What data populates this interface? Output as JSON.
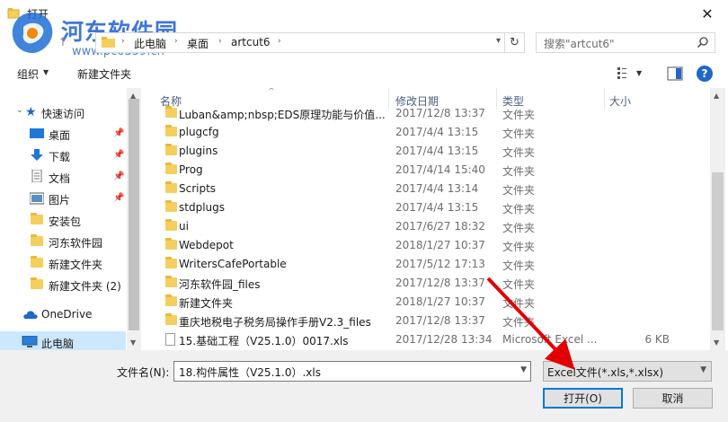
{
  "window": {
    "title": "打开",
    "close_glyph": "✕"
  },
  "watermark": {
    "text": "河东软件园",
    "url": "www.pc0359.cn"
  },
  "address": {
    "crumbs": [
      "此电脑",
      "桌面",
      "artcut6"
    ],
    "refresh_glyph": "↻"
  },
  "search": {
    "placeholder": "搜索\"artcut6\""
  },
  "toolbar": {
    "organize_label": "组织",
    "new_folder_label": "新建文件夹"
  },
  "sidebar": {
    "items": [
      {
        "label": "快速访问",
        "icon": "star-icon"
      },
      {
        "label": "桌面",
        "icon": "desktop-icon",
        "pinned": true
      },
      {
        "label": "下载",
        "icon": "download-icon",
        "pinned": true
      },
      {
        "label": "文档",
        "icon": "document-icon",
        "pinned": true
      },
      {
        "label": "图片",
        "icon": "picture-icon",
        "pinned": true
      },
      {
        "label": "安装包",
        "icon": "folder-icon"
      },
      {
        "label": "河东软件园",
        "icon": "folder-icon"
      },
      {
        "label": "新建文件夹",
        "icon": "folder-icon"
      },
      {
        "label": "新建文件夹 (2)",
        "icon": "folder-icon"
      },
      {
        "label": "OneDrive",
        "icon": "cloud-icon"
      },
      {
        "label": "此电脑",
        "icon": "computer-icon",
        "selected": true
      }
    ]
  },
  "columns": {
    "name": "名称",
    "date": "修改日期",
    "type": "类型",
    "size": "大小"
  },
  "files": [
    {
      "name": "Luban&amp;nbsp;EDS原理功能与价值...",
      "date": "2017/12/8 13:37",
      "type": "文件夹",
      "size": "",
      "kind": "folder"
    },
    {
      "name": "plugcfg",
      "date": "2017/4/4 13:15",
      "type": "文件夹",
      "size": "",
      "kind": "folder"
    },
    {
      "name": "plugins",
      "date": "2017/4/4 13:15",
      "type": "文件夹",
      "size": "",
      "kind": "folder"
    },
    {
      "name": "Prog",
      "date": "2017/4/14 15:40",
      "type": "文件夹",
      "size": "",
      "kind": "folder"
    },
    {
      "name": "Scripts",
      "date": "2017/4/4 13:14",
      "type": "文件夹",
      "size": "",
      "kind": "folder"
    },
    {
      "name": "stdplugs",
      "date": "2017/4/4 13:15",
      "type": "文件夹",
      "size": "",
      "kind": "folder"
    },
    {
      "name": "ui",
      "date": "2017/6/27 18:32",
      "type": "文件夹",
      "size": "",
      "kind": "folder"
    },
    {
      "name": "Webdepot",
      "date": "2018/1/27 10:37",
      "type": "文件夹",
      "size": "",
      "kind": "folder"
    },
    {
      "name": "WritersCafePortable",
      "date": "2017/5/12 17:13",
      "type": "文件夹",
      "size": "",
      "kind": "folder"
    },
    {
      "name": "河东软件园_files",
      "date": "2017/12/8 13:37",
      "type": "文件夹",
      "size": "",
      "kind": "folder"
    },
    {
      "name": "新建文件夹",
      "date": "2018/1/27 10:37",
      "type": "文件夹",
      "size": "",
      "kind": "folder"
    },
    {
      "name": "重庆地税电子税务局操作手册V2.3_files",
      "date": "2017/12/8 13:37",
      "type": "文件夹",
      "size": "",
      "kind": "folder"
    },
    {
      "name": "15.基础工程（V25.1.0）0017.xls",
      "date": "2017/12/28 13:34",
      "type": "Microsoft Excel ...",
      "size": "6 KB",
      "kind": "file"
    }
  ],
  "footer": {
    "filename_label": "文件名(N):",
    "filename_value": "18.构件属性（V25.1.0）.xls",
    "filter_value": "Excel文件(*.xls,*.xlsx)",
    "open_label": "打开(O)",
    "cancel_label": "取消"
  },
  "colors": {
    "accent": "#0078d7",
    "arrow": "#e00000",
    "folder": "#f5cf5e"
  }
}
